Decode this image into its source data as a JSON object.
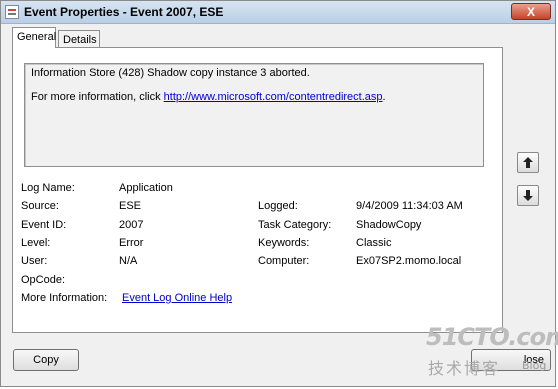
{
  "window": {
    "title": "Event Properties - Event 2007, ESE",
    "close_label": "X"
  },
  "tabs": [
    {
      "label": "General",
      "active": true
    },
    {
      "label": "Details",
      "active": false
    }
  ],
  "message": {
    "line1": "Information Store (428) Shadow copy instance 3 aborted.",
    "line2_prefix": "For more information, click ",
    "line2_link": "http://www.microsoft.com/contentredirect.asp",
    "line2_suffix": "."
  },
  "fields": {
    "log_name": {
      "label": "Log Name:",
      "value": "Application"
    },
    "source": {
      "label": "Source:",
      "value": "ESE"
    },
    "event_id": {
      "label": "Event ID:",
      "value": "2007"
    },
    "level": {
      "label": "Level:",
      "value": "Error"
    },
    "user": {
      "label": "User:",
      "value": "N/A"
    },
    "opcode": {
      "label": "OpCode:",
      "value": ""
    },
    "more_info": {
      "label": "More Information:",
      "value": "Event Log Online Help"
    },
    "logged": {
      "label": "Logged:",
      "value": "9/4/2009 11:34:03 AM"
    },
    "task_category": {
      "label": "Task Category:",
      "value": "ShadowCopy"
    },
    "keywords": {
      "label": "Keywords:",
      "value": "Classic"
    },
    "computer": {
      "label": "Computer:",
      "value": "Ex07SP2.momo.local"
    }
  },
  "buttons": {
    "copy": "Copy",
    "close": "lose"
  },
  "watermark": {
    "top": "51CTO.com",
    "bottom": "技术博客",
    "blog": "Blog"
  },
  "icons": [
    "event-log-icon",
    "arrow-up-icon",
    "arrow-down-icon"
  ]
}
